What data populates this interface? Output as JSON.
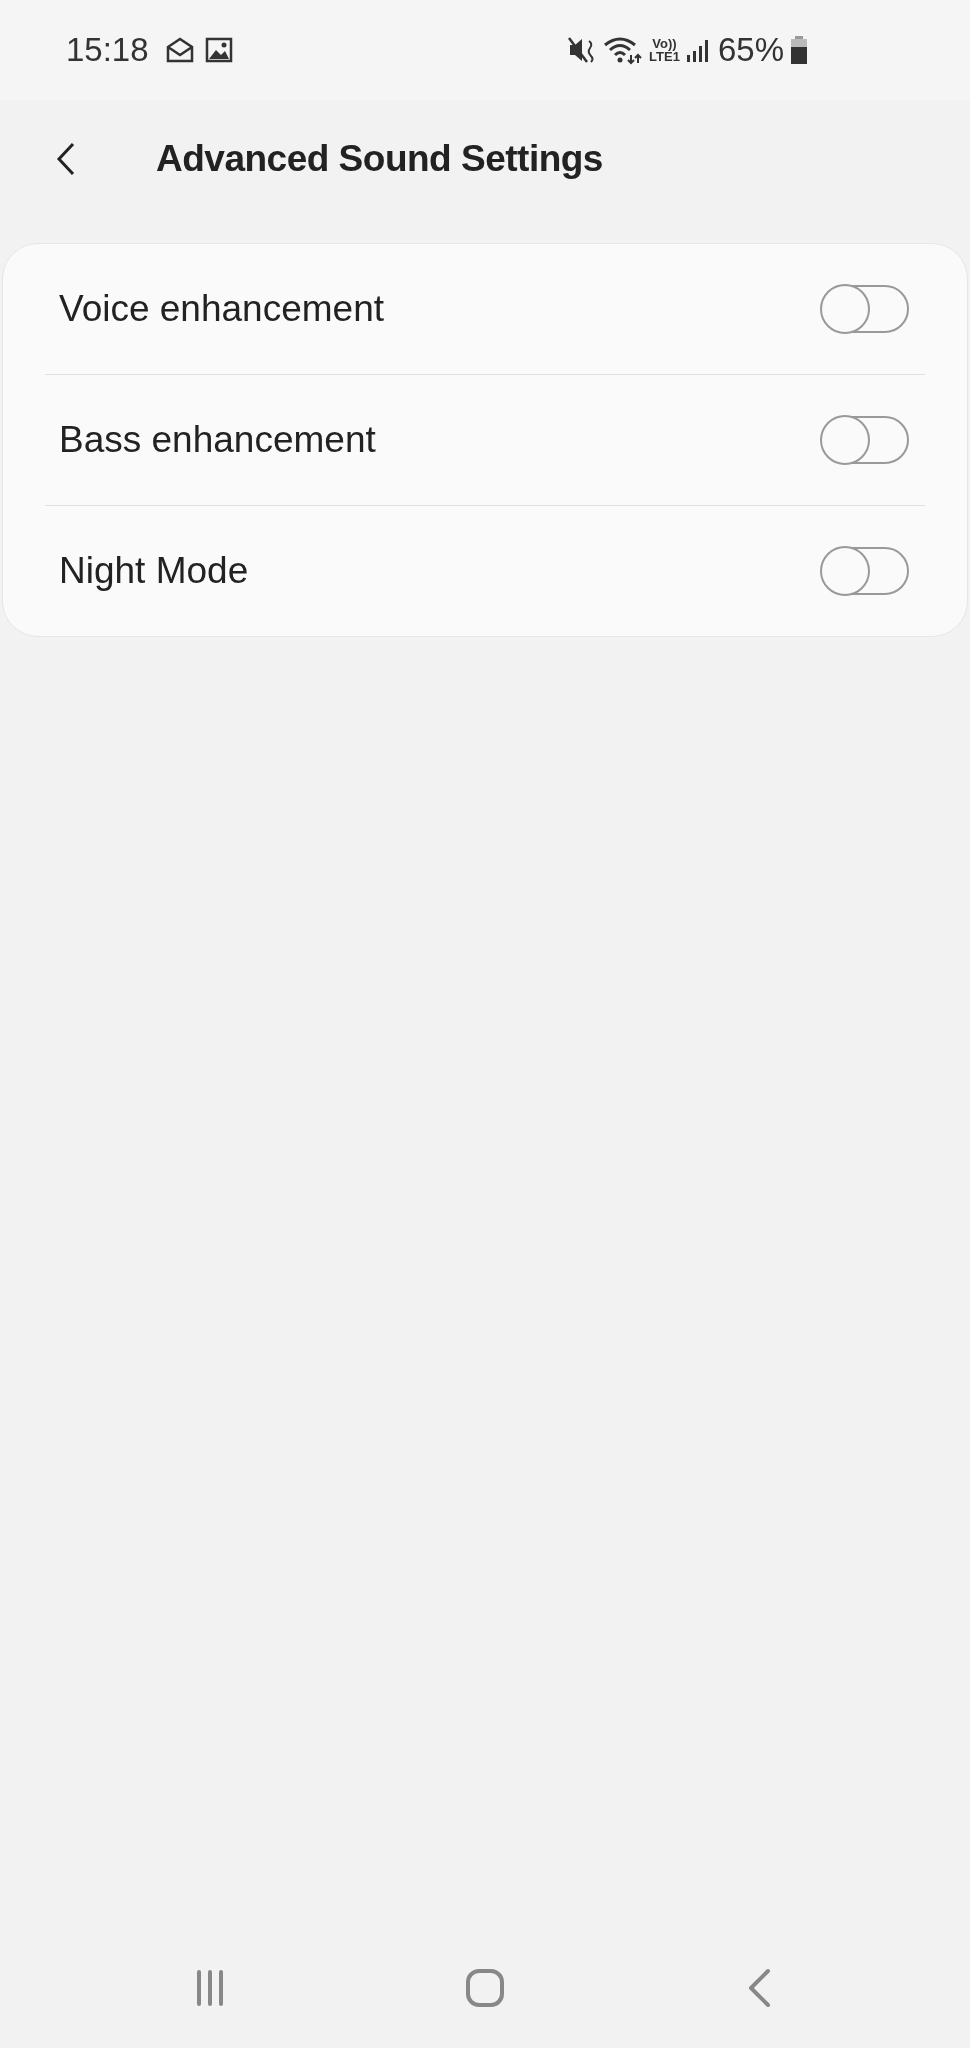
{
  "status_bar": {
    "time": "15:18",
    "network_top": "Vo))",
    "network_bottom": "LTE1",
    "battery": "65%"
  },
  "header": {
    "title": "Advanced Sound Settings"
  },
  "settings": [
    {
      "label": "Voice enhancement",
      "on": false
    },
    {
      "label": "Bass enhancement",
      "on": false
    },
    {
      "label": "Night Mode",
      "on": false
    }
  ]
}
